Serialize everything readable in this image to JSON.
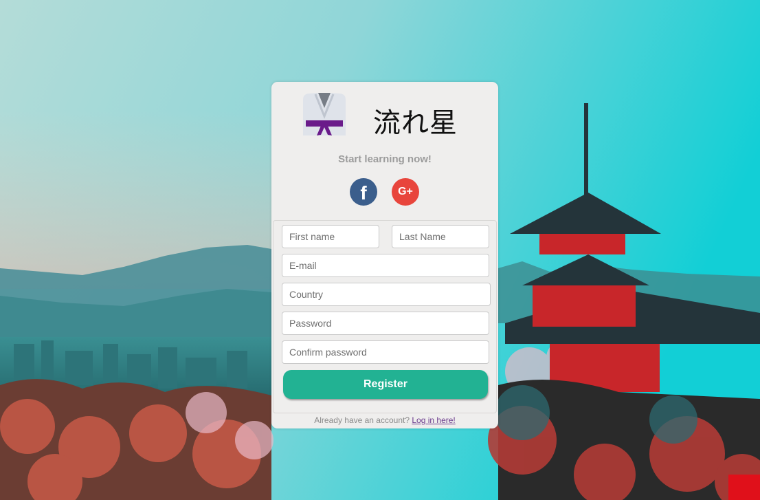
{
  "brand": {
    "logo_icon": "judo-gi-icon",
    "title": "流れ星",
    "tagline": "Start learning now!"
  },
  "social": {
    "facebook_icon": "facebook-icon",
    "facebook_glyph": "f",
    "google_icon": "google-plus-icon",
    "google_glyph": "G+"
  },
  "form": {
    "first_name_placeholder": "First name",
    "last_name_placeholder": "Last Name",
    "email_placeholder": "E-mail",
    "country_placeholder": "Country",
    "password_placeholder": "Password",
    "confirm_password_placeholder": "Confirm password",
    "register_label": "Register"
  },
  "footer": {
    "prompt": "Already have an account?",
    "login_link": "Log in here!"
  },
  "colors": {
    "card_bg": "#efeeed",
    "register_bg": "#22b293",
    "facebook": "#3b5e8c",
    "google": "#e8453c",
    "belt": "#6a1b8a"
  }
}
